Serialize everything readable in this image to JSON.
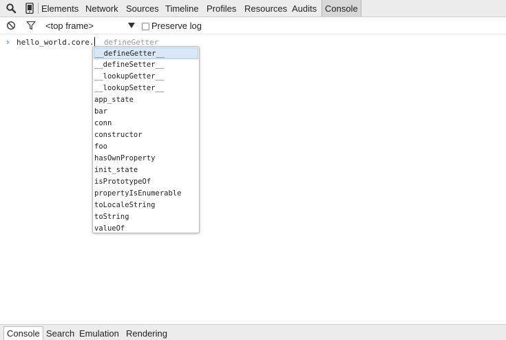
{
  "top_tabs": [
    {
      "label": "Elements"
    },
    {
      "label": "Network"
    },
    {
      "label": "Sources"
    },
    {
      "label": "Timeline"
    },
    {
      "label": "Profiles"
    },
    {
      "label": "Resources"
    },
    {
      "label": "Audits"
    },
    {
      "label": "Console",
      "selected": true
    }
  ],
  "icons": {
    "search": "search-icon",
    "device": "device-mode-icon",
    "clear": "clear-console-icon",
    "filter": "filter-icon",
    "dropdown": "chevron-down-icon"
  },
  "toolbar": {
    "frame_select": "<top frame>",
    "preserve_log_label": "Preserve log",
    "preserve_log_checked": false
  },
  "console": {
    "prompt_symbol": "›",
    "input_text": "hello_world.core.",
    "ghost_completion": "__defineGetter__"
  },
  "autocomplete": {
    "selected_index": 0,
    "items": [
      "__defineGetter__",
      "__defineSetter__",
      "__lookupGetter__",
      "__lookupSetter__",
      "app_state",
      "bar",
      "conn",
      "constructor",
      "foo",
      "hasOwnProperty",
      "init_state",
      "isPrototypeOf",
      "propertyIsEnumerable",
      "toLocaleString",
      "toString",
      "valueOf"
    ]
  },
  "drawer_tabs": [
    {
      "label": "Console",
      "selected": true
    },
    {
      "label": "Search"
    },
    {
      "label": "Emulation"
    },
    {
      "label": "Rendering"
    }
  ],
  "colors": {
    "prompt_caret": "#2b76d8",
    "selection_bg": "#d9e7f8",
    "ghost_text": "#9a9a9a"
  }
}
